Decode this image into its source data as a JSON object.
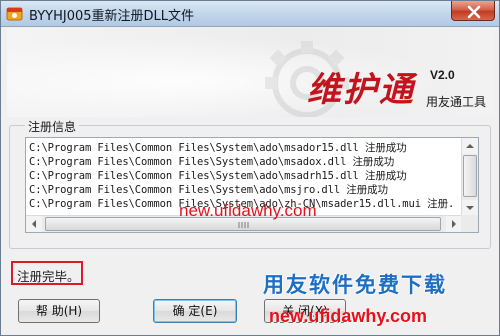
{
  "window": {
    "title": "BYYHJ005重新注册DLL文件",
    "icon": "app-icon",
    "close_icon": "close-icon"
  },
  "banner": {
    "logo_text": "维护通",
    "version": "V2.0",
    "subtitle": "用友通工具"
  },
  "registration": {
    "group_label": "注册信息",
    "lines": [
      "C:\\Program Files\\Common Files\\System\\ado\\msador15.dll 注册成功",
      "C:\\Program Files\\Common Files\\System\\ado\\msadox.dll 注册成功",
      "C:\\Program Files\\Common Files\\System\\ado\\msadrh15.dll 注册成功",
      "C:\\Program Files\\Common Files\\System\\ado\\msjro.dll 注册成功",
      "C:\\Program Files\\Common Files\\System\\ado\\zh-CN\\msader15.dll.mui 注册."
    ],
    "scrollbar_grip_icon": "grip-icon"
  },
  "watermark": {
    "url_top": "new.ufidawhy.com",
    "url_bottom": "new.ufidawhy.com",
    "promo": "用友软件免费下载"
  },
  "status": {
    "text": "注册完毕。"
  },
  "buttons": {
    "help": "帮 助(H)",
    "ok": "确 定(E)",
    "close": "关 闭(X)"
  },
  "colors": {
    "accent_red": "#c2141c",
    "watermark_red": "#e8101c",
    "promo_blue": "#1d6fc4",
    "highlight_border": "#d91c2a"
  }
}
